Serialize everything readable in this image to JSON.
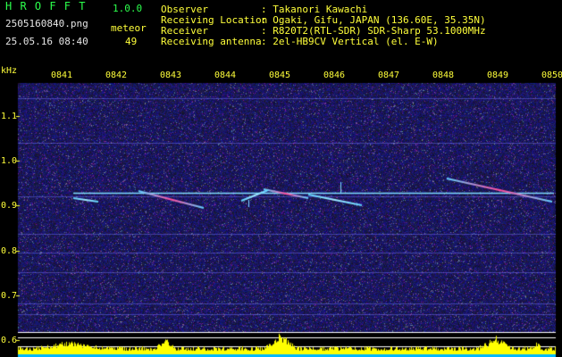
{
  "app": {
    "logo": "H R O F F T",
    "version": "1.0.0"
  },
  "file": {
    "name": "2505160840.png",
    "datetime": "25.05.16 08:40"
  },
  "counter": {
    "label": "meteor",
    "value": "49"
  },
  "info": [
    {
      "key": "Observer",
      "value": ": Takanori Kawachi"
    },
    {
      "key": "Receiving Location",
      "value": ": Ogaki, Gifu, JAPAN (136.60E, 35.35N)"
    },
    {
      "key": "Receiver",
      "value": ": R820T2(RTL-SDR) SDR-Sharp 53.1000MHz"
    },
    {
      "key": "Receiving antenna",
      "value": ": 2el-HB9CV Vertical (el. E-W)"
    }
  ],
  "axes": {
    "y_unit": "kHz",
    "x_ticks": [
      "0841",
      "0842",
      "0843",
      "0844",
      "0845",
      "0846",
      "0847",
      "0848",
      "0849",
      "0850"
    ],
    "y_ticks": [
      "1.1",
      "1.0",
      "0.9",
      "0.8",
      "0.7",
      "0.6"
    ]
  },
  "colors": {
    "background": "#000000",
    "noise": "#1a1c8a",
    "carrier": "#6ad8ff",
    "meteor_hot": "#ff3a8a",
    "label_yellow": "#ffff3a",
    "label_green": "#2cff4c",
    "histogram": "#ffff00",
    "histogram_base": "#00b8ff"
  }
}
